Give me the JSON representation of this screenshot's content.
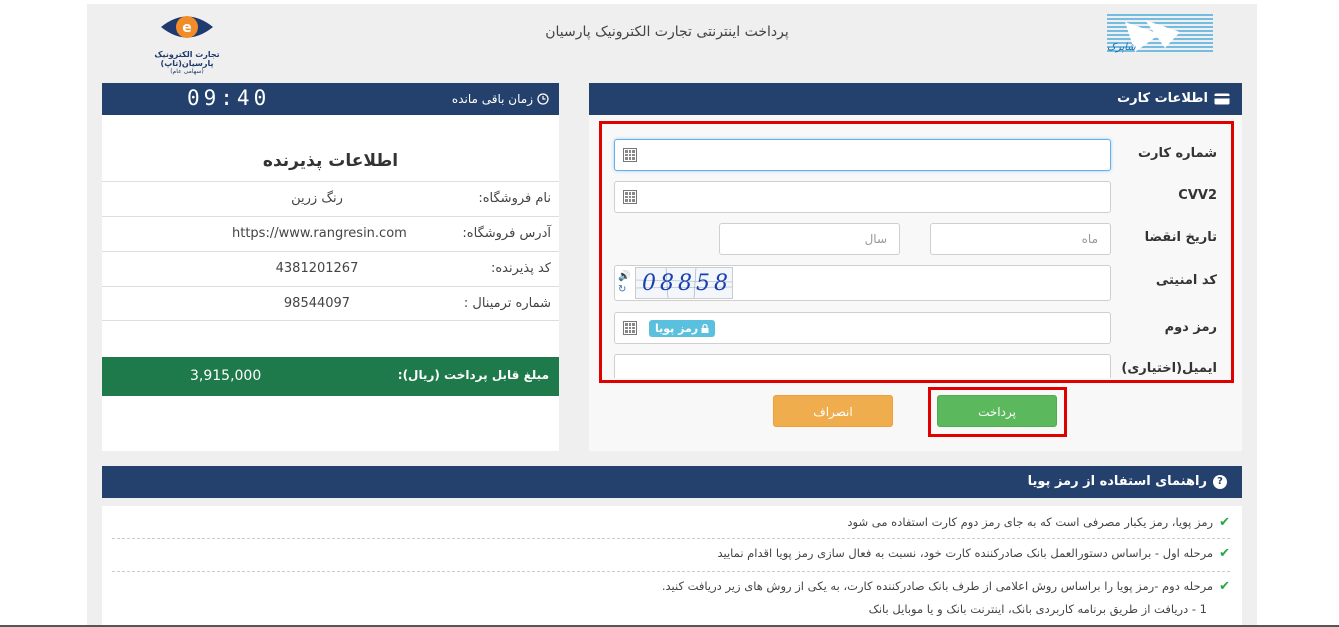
{
  "header": {
    "site_title": "پرداخت اینترنتی تجارت الکترونیک پارسیان",
    "logo_tap_line1": "تجارت الکترونیک پارسیان(تاپ)",
    "logo_tap_line2": "(سهامی عام)",
    "logo_shaparak_text": "شاپرک"
  },
  "card_form": {
    "title": "اطلاعات کارت",
    "card_number_label": "شماره کارت",
    "card_number_value": "",
    "cvv2_label": "CVV2",
    "cvv2_value": "",
    "expiry_label": "تاریخ انقضا",
    "expiry_month_placeholder": "ماه",
    "expiry_year_placeholder": "سال",
    "captcha_label": "کد امنیتی",
    "captcha_text": "08858",
    "second_pin_label": "رمز دوم",
    "dynamic_pin_badge": "رمز پویا",
    "email_label": "ایمیل(اختیاری)",
    "email_value": "",
    "pay_button": "پرداخت",
    "cancel_button": "انصراف"
  },
  "timer": {
    "label": "زمان باقی مانده",
    "value": "09:40"
  },
  "merchant": {
    "title": "اطلاعات پذیرنده",
    "rows": [
      {
        "key": "نام فروشگاه:",
        "value": "رنگ زرین"
      },
      {
        "key": "آدرس فروشگاه:",
        "value": "https://www.rangresin.com"
      },
      {
        "key": "کد پذیرنده:",
        "value": "4381201267"
      },
      {
        "key": "شماره ترمینال :",
        "value": "98544097"
      }
    ],
    "amount_label": "مبلغ قابل پرداخت (ریال):",
    "amount_value": "3,915,000"
  },
  "guide": {
    "title": "راهنمای استفاده از رمز پویا",
    "items": [
      "رمز پویا، رمز یکبار مصرفی است که به جای رمز دوم کارت استفاده می شود",
      "مرحله اول - براساس دستورالعمل بانک صادرکننده کارت خود، نسبت به فعال سازی رمز پویا اقدام نمایید",
      "مرحله دوم -رمز پویا را براساس روش اعلامی از طرف بانک صادرکننده کارت، به یکی از روش های زیر دریافت کنید."
    ],
    "sub_item": "1 - دریافت از طریق برنامه کاربردی بانک، اینترنت بانک و یا موبایل بانک"
  },
  "colors": {
    "panel_header": "#24416e",
    "amount_bar": "#1e7a4a",
    "pay_button": "#5cb85c",
    "cancel_button": "#f0ad4e",
    "highlight_box": "#e10000",
    "dynamic_pin_badge": "#5bc0de"
  }
}
